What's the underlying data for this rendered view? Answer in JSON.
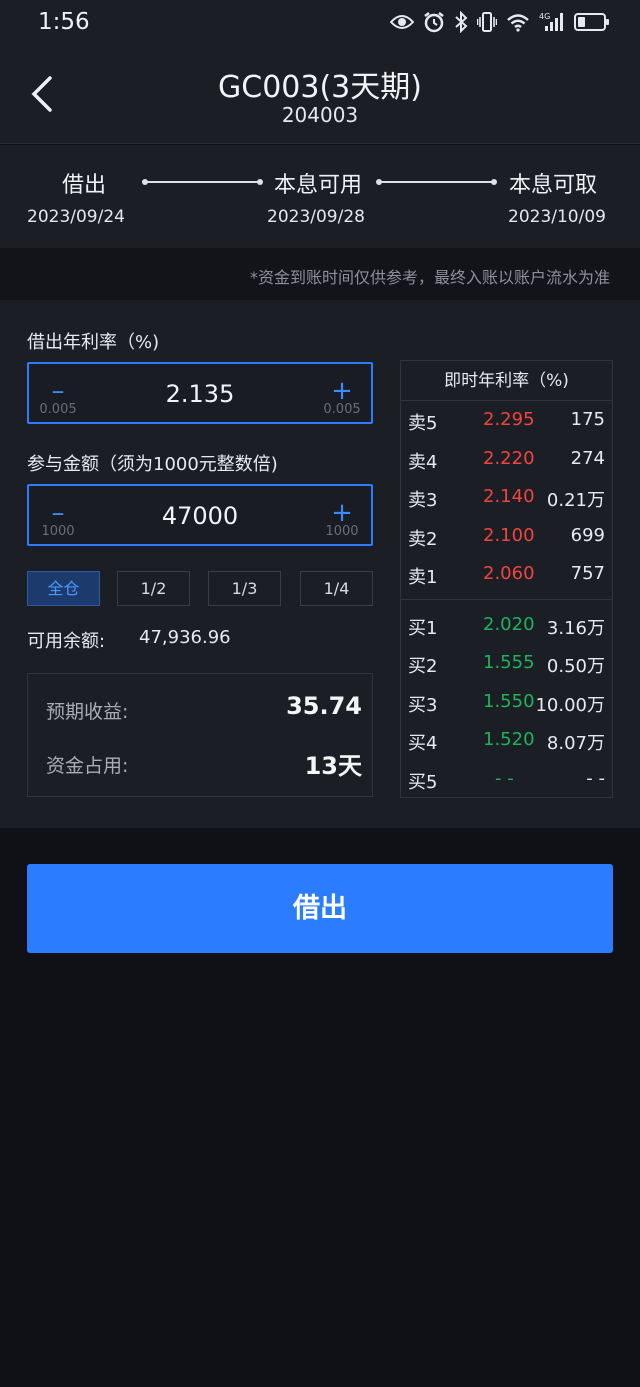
{
  "status_bar": {
    "time": "1:56",
    "icons": [
      "eye-icon",
      "alarm-icon",
      "bluetooth-icon",
      "vibrate-icon",
      "wifi-icon",
      "signal-4g-icon",
      "battery-icon"
    ]
  },
  "header": {
    "title": "GC003(3天期)",
    "code": "204003"
  },
  "timeline": {
    "steps": [
      {
        "label": "借出",
        "date": "2023/09/24"
      },
      {
        "label": "本息可用",
        "date": "2023/09/28"
      },
      {
        "label": "本息可取",
        "date": "2023/10/09"
      }
    ]
  },
  "notice": "*资金到账时间仅供参考，最终入账以账户流水为准",
  "form": {
    "rate_label": "借出年利率（%)",
    "rate": {
      "value": "2.135",
      "step_down": "0.005",
      "step_up": "0.005"
    },
    "amount_label": "参与金额（须为1000元整数倍)",
    "amount": {
      "value": "47000",
      "step_down": "1000",
      "step_up": "1000"
    },
    "ratios": [
      "全仓",
      "1/2",
      "1/3",
      "1/4"
    ],
    "available_label": "可用余额:",
    "available_value": "47,936.96",
    "expected_income_label": "预期收益:",
    "expected_income_value": "35.74",
    "occupy_label": "资金占用:",
    "occupy_value": "13天"
  },
  "order_book": {
    "title": "即时年利率（%)",
    "sells": [
      {
        "side": "卖5",
        "rate": "2.295",
        "volume": "175"
      },
      {
        "side": "卖4",
        "rate": "2.220",
        "volume": "274"
      },
      {
        "side": "卖3",
        "rate": "2.140",
        "volume": "0.21万"
      },
      {
        "side": "卖2",
        "rate": "2.100",
        "volume": "699"
      },
      {
        "side": "卖1",
        "rate": "2.060",
        "volume": "757"
      }
    ],
    "buys": [
      {
        "side": "买1",
        "rate": "2.020",
        "volume": "3.16万"
      },
      {
        "side": "买2",
        "rate": "1.555",
        "volume": "0.50万"
      },
      {
        "side": "买3",
        "rate": "1.550",
        "volume": "10.00万"
      },
      {
        "side": "买4",
        "rate": "1.520",
        "volume": "8.07万"
      },
      {
        "side": "买5",
        "rate": "- -",
        "volume": "- -"
      }
    ]
  },
  "submit_label": "借出",
  "colors": {
    "accent": "#2b7cff",
    "sell": "#f0453e",
    "buy": "#1fb35a"
  }
}
